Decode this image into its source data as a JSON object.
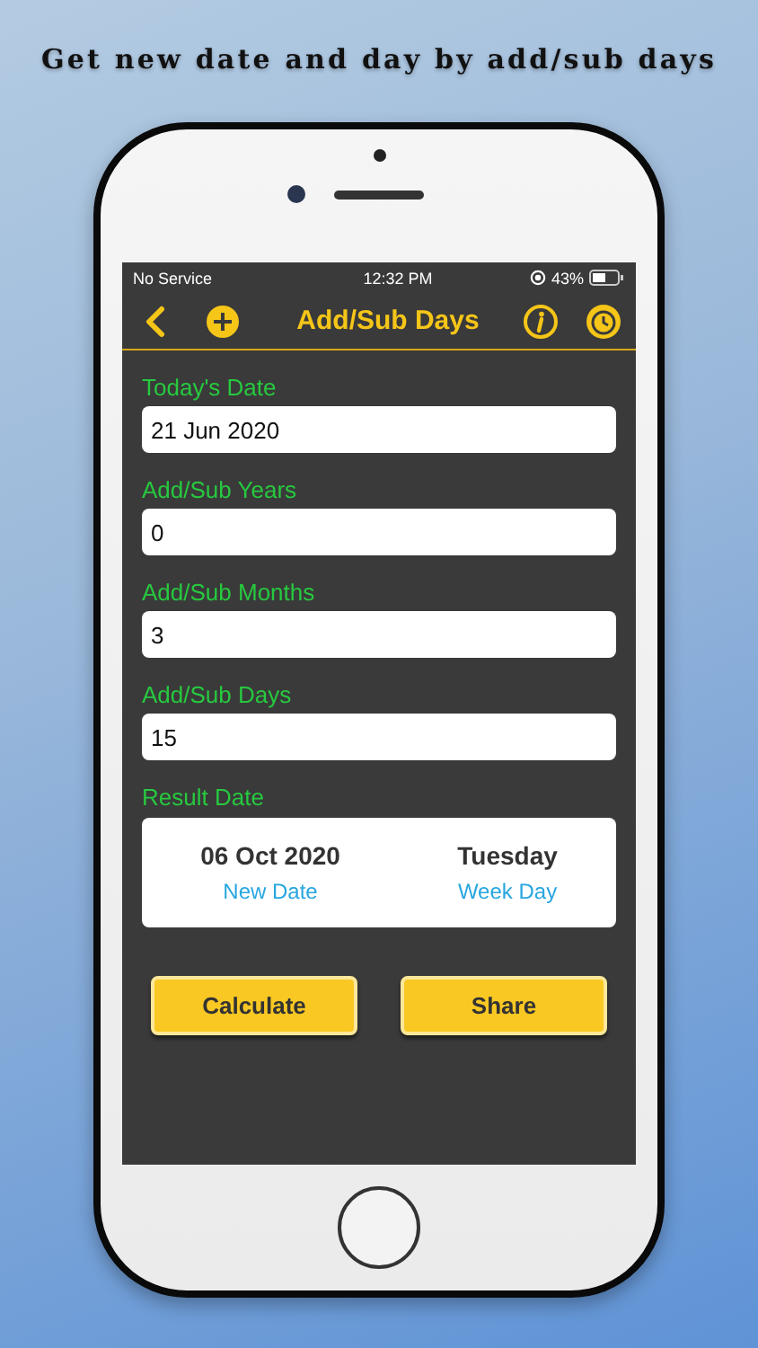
{
  "headline": "Get new date and day by add/sub days",
  "status_bar": {
    "carrier": "No Service",
    "time": "12:32 PM",
    "battery": "43%"
  },
  "nav": {
    "title": "Add/Sub Days"
  },
  "fields": [
    {
      "label": "Today's Date",
      "value": "21 Jun 2020"
    },
    {
      "label": "Add/Sub Years",
      "value": "0"
    },
    {
      "label": "Add/Sub Months",
      "value": "3"
    },
    {
      "label": "Add/Sub Days",
      "value": "15"
    }
  ],
  "result": {
    "label": "Result Date",
    "items": [
      {
        "value": "06 Oct 2020",
        "caption": "New Date"
      },
      {
        "value": "Tuesday",
        "caption": "Week Day"
      }
    ]
  },
  "buttons": [
    "Calculate",
    "Share"
  ]
}
